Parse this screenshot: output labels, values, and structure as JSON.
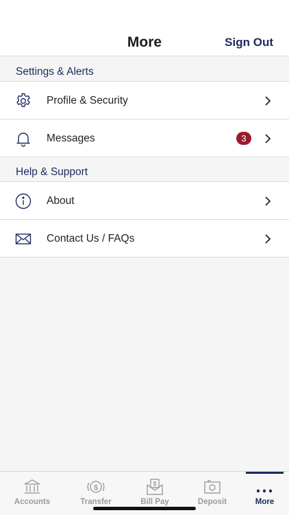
{
  "header": {
    "title": "More",
    "sign_out": "Sign Out"
  },
  "sections": [
    {
      "title": "Settings & Alerts",
      "items": [
        {
          "label": "Profile & Security",
          "icon": "gear-icon"
        },
        {
          "label": "Messages",
          "icon": "bell-icon",
          "badge": "3"
        }
      ]
    },
    {
      "title": "Help & Support",
      "items": [
        {
          "label": "About",
          "icon": "info-icon"
        },
        {
          "label": "Contact Us / FAQs",
          "icon": "envelope-icon"
        }
      ]
    }
  ],
  "tabs": [
    {
      "label": "Accounts",
      "icon": "bank-icon"
    },
    {
      "label": "Transfer",
      "icon": "transfer-icon"
    },
    {
      "label": "Bill Pay",
      "icon": "bill-pay-icon"
    },
    {
      "label": "Deposit",
      "icon": "camera-icon"
    },
    {
      "label": "More",
      "icon": "more-dots-icon",
      "active": true
    }
  ],
  "colors": {
    "accent": "#1b2a5e",
    "badge": "#9b1b2e",
    "inactive_tab": "#9a9a9a"
  }
}
